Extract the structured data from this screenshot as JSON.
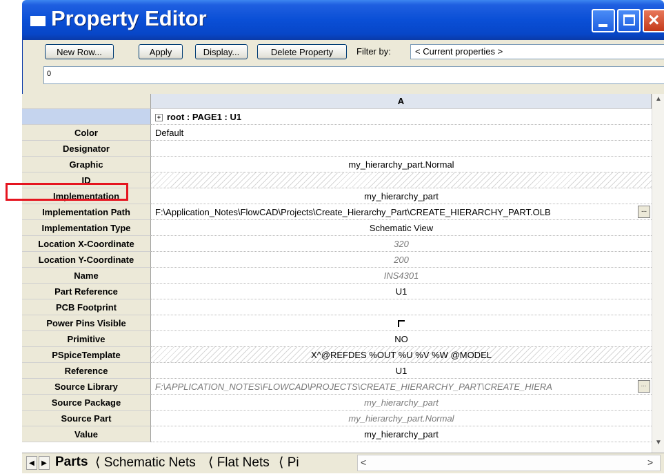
{
  "window": {
    "title": "Property Editor"
  },
  "toolbar": {
    "new_row": "New Row...",
    "apply": "Apply",
    "display": "Display...",
    "delete_property": "Delete Property",
    "filter_label": "Filter by:",
    "filter_value": "< Current properties >",
    "value_box": "0"
  },
  "grid": {
    "column_header": "A",
    "root_label": "root : PAGE1 : U1",
    "rows": [
      {
        "name": "Color",
        "value": "Default",
        "align": "left"
      },
      {
        "name": "Designator",
        "value": ""
      },
      {
        "name": "Graphic",
        "value": "my_hierarchy_part.Normal"
      },
      {
        "name": "ID",
        "value": "",
        "hatched": true
      },
      {
        "name": "Implementation",
        "value": "my_hierarchy_part"
      },
      {
        "name": "Implementation Path",
        "value": "F:\\Application_Notes\\FlowCAD\\Projects\\Create_Hierarchy_Part\\CREATE_HIERARCHY_PART.OLB",
        "align": "left",
        "browse": "..."
      },
      {
        "name": "Implementation Type",
        "value": "Schematic View"
      },
      {
        "name": "Location X-Coordinate",
        "value": "320",
        "italic": true
      },
      {
        "name": "Location Y-Coordinate",
        "value": "200",
        "italic": true
      },
      {
        "name": "Name",
        "value": "INS4301",
        "italic": true
      },
      {
        "name": "Part Reference",
        "value": "U1"
      },
      {
        "name": "PCB Footprint",
        "value": ""
      },
      {
        "name": "Power Pins Visible",
        "value": "",
        "checkbox": true,
        "checked": false
      },
      {
        "name": "Primitive",
        "value": "NO"
      },
      {
        "name": "PSpiceTemplate",
        "value": "X^@REFDES %OUT %U %V %W @MODEL",
        "hatched": true
      },
      {
        "name": "Reference",
        "value": "U1"
      },
      {
        "name": "Source Library",
        "value": "F:\\APPLICATION_NOTES\\FLOWCAD\\PROJECTS\\CREATE_HIERARCHY_PART\\CREATE_HIERA",
        "italic": true,
        "align": "left",
        "browse": "..."
      },
      {
        "name": "Source Package",
        "value": "my_hierarchy_part",
        "italic": true
      },
      {
        "name": "Source Part",
        "value": "my_hierarchy_part.Normal",
        "italic": true
      },
      {
        "name": "Value",
        "value": "my_hierarchy_part"
      }
    ]
  },
  "tabs": {
    "prev": "◀",
    "next": "▶",
    "items": [
      {
        "label": "Parts",
        "active": true
      },
      {
        "label": "Schematic Nets"
      },
      {
        "label": "Flat Nets"
      },
      {
        "label": "Pi"
      }
    ],
    "hscroll_left": "<",
    "hscroll_right": ">"
  },
  "colors": {
    "title_bar": "#0a4fd6",
    "annotation": "#e5141f",
    "header_bg": "#ece9d8"
  }
}
